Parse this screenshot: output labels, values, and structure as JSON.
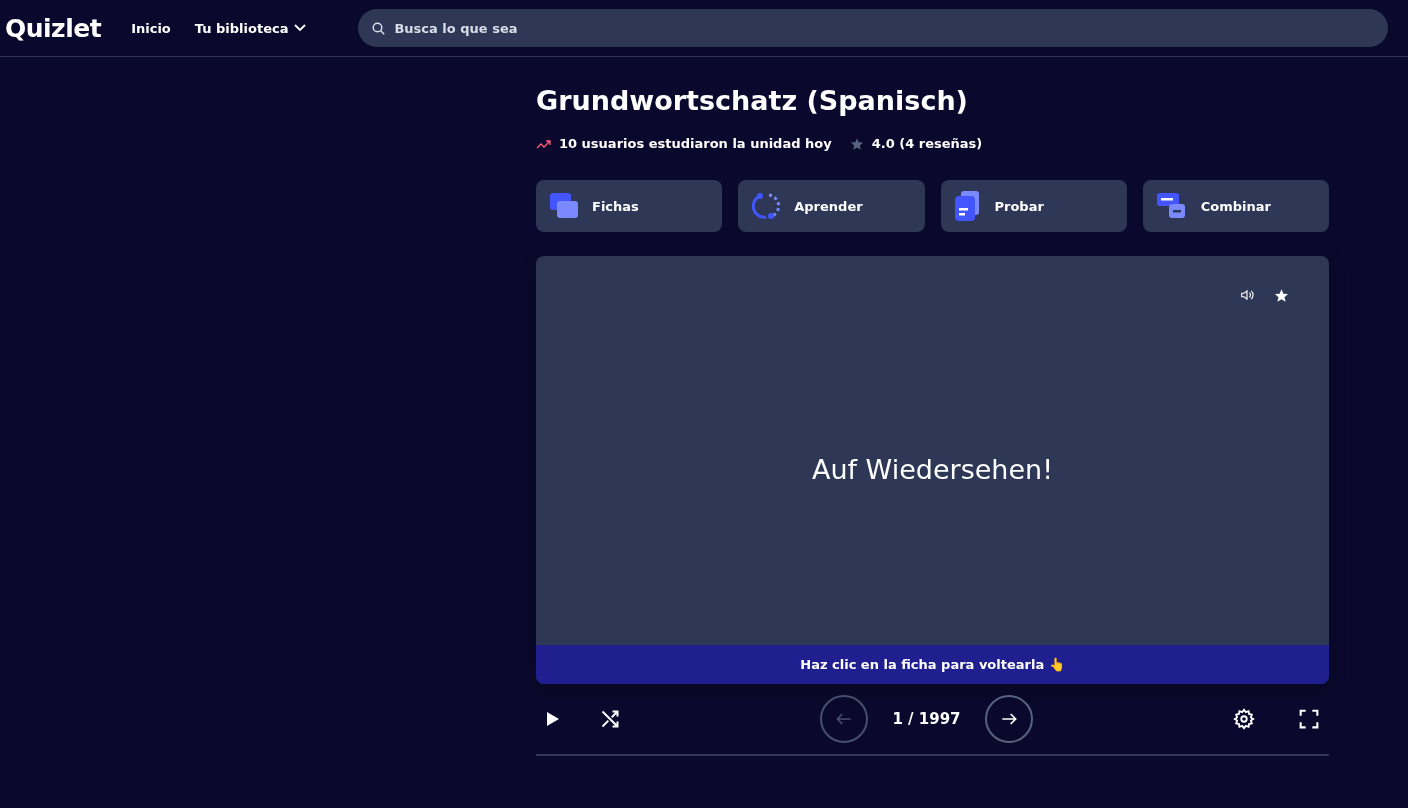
{
  "header": {
    "logo": "Quizlet",
    "nav": [
      {
        "label": "Inicio",
        "dropdown": false
      },
      {
        "label": "Tu biblioteca",
        "dropdown": true
      }
    ],
    "search": {
      "placeholder": "Busca lo que sea"
    }
  },
  "set": {
    "title": "Grundwortschatz (Spanisch)",
    "activity": "10 usuarios estudiaron la unidad hoy",
    "rating": "4.0 (4 reseñas)"
  },
  "modes": [
    {
      "label": "Fichas",
      "kind": "cards"
    },
    {
      "label": "Aprender",
      "kind": "learn"
    },
    {
      "label": "Probar",
      "kind": "test"
    },
    {
      "label": "Combinar",
      "kind": "match"
    }
  ],
  "flashcard": {
    "term": "Auf Wiedersehen!",
    "hint": "Haz clic en la ficha para voltearla 👆"
  },
  "controls": {
    "counter": "1 / 1997",
    "previous_disabled": true,
    "next_disabled": false
  }
}
